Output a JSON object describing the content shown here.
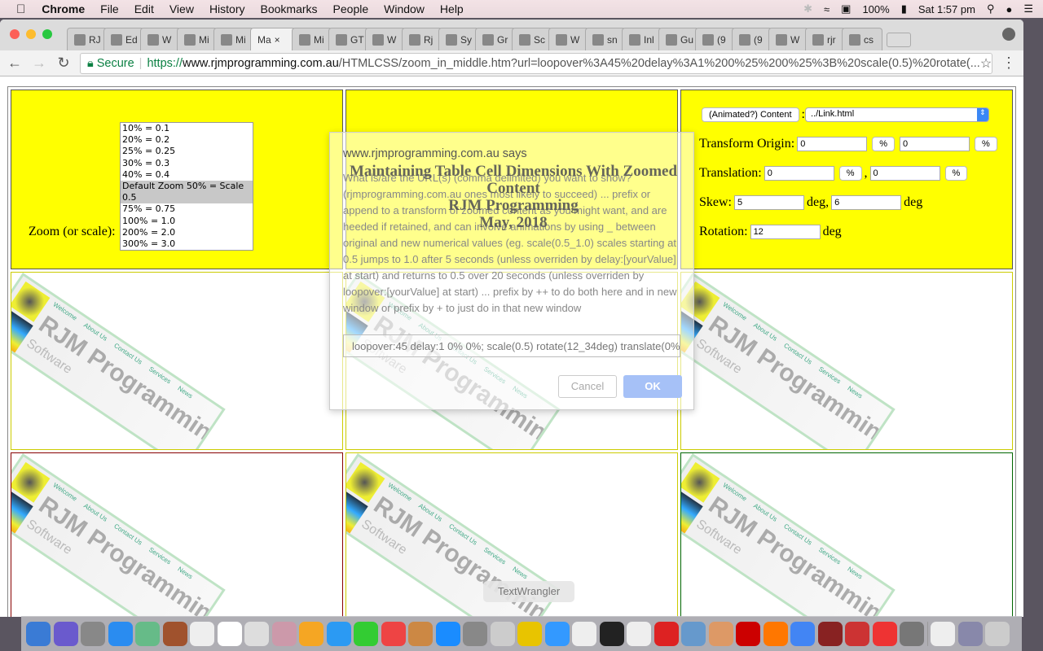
{
  "menubar": {
    "app": "Chrome",
    "items": [
      "File",
      "Edit",
      "View",
      "History",
      "Bookmarks",
      "People",
      "Window",
      "Help"
    ],
    "battery": "100%",
    "clock": "Sat 1:57 pm"
  },
  "tabs": [
    "RJ",
    "Ed",
    "W",
    "Mi",
    "Mi",
    "Ma",
    "Mi",
    "GT",
    "W",
    "Rj",
    "Sy",
    "Gr",
    "Sc",
    "W",
    "sn",
    "Inl",
    "Gu",
    "(9",
    "(9",
    "W",
    "rjr",
    "cs"
  ],
  "active_tab_index": 5,
  "address": {
    "secure_label": "Secure",
    "scheme": "https://",
    "host": "www.rjmprogramming.com.au",
    "path": "/HTMLCSS/zoom_in_middle.htm?url=loopover%3A45%20delay%3A1%200%25%200%25%3B%20scale(0.5)%20rotate(..."
  },
  "controls": {
    "zoom_label": "Zoom (or scale):",
    "zoom_options": [
      "10% = 0.1",
      "20% = 0.2",
      "25% = 0.25",
      "30% = 0.3",
      "40% = 0.4",
      "Default Zoom 50% = Scale 0.5",
      "75% = 0.75",
      "100% = 1.0",
      "200% = 2.0",
      "300% = 3.0"
    ],
    "zoom_selected_index": 5,
    "content_button": "(Animated?) Content",
    "colon": ":",
    "content_select": "../Link.html",
    "origin_label": "Transform Origin:",
    "origin_x": "0",
    "origin_y": "0",
    "translation_label": "Translation:",
    "translate_x": "0",
    "translate_y": "0",
    "pct": "%",
    "skew_label": "Skew:",
    "skew_x": "5",
    "skew_y": "6",
    "rotation_label": "Rotation:",
    "rotation": "12",
    "deg": "deg",
    "deg_comma": "deg,",
    "comma": ","
  },
  "thumbnail": {
    "nav": [
      "Welcome",
      "About Us",
      "Contact Us",
      "Services",
      "News"
    ],
    "brand": "RJM Programming",
    "tagline": "Software"
  },
  "heading": {
    "line1": "Maintaining Table Cell Dimensions With Zoomed Content",
    "line2": "RJM Programming",
    "line3": "May, 2018"
  },
  "dialog": {
    "title": "www.rjmprogramming.com.au says",
    "message": "What is/are the URL(s) (comma delimited) you want to show? (rjmprogramming.com.au ones most likely to succeed) ... prefix or append to a transform of zoomed content as you might want, and are heeded if retained, and can involve animations by using _ between original and new numerical values (eg. scale(0.5_1.0) scales starting at 0.5 jumps to 1.0 after 5 seconds (unless overriden by delay:[yourValue] at start) and returns to 0.5 over 20 seconds (unless overriden by loopover:[yourValue] at start) ... prefix by ++ to do both here and in new window or prefix by + to just do in that new window",
    "input_value": "loopover:45  delay:1  0% 0%; scale(0.5) rotate(12_34deg) translate(0%,",
    "cancel": "Cancel",
    "ok": "OK"
  },
  "dock": {
    "tooltip": "TextWrangler"
  },
  "colors": {
    "cell_background": "#ffff00",
    "ok_button": "#a6c1f7",
    "secure": "#0b8043"
  }
}
